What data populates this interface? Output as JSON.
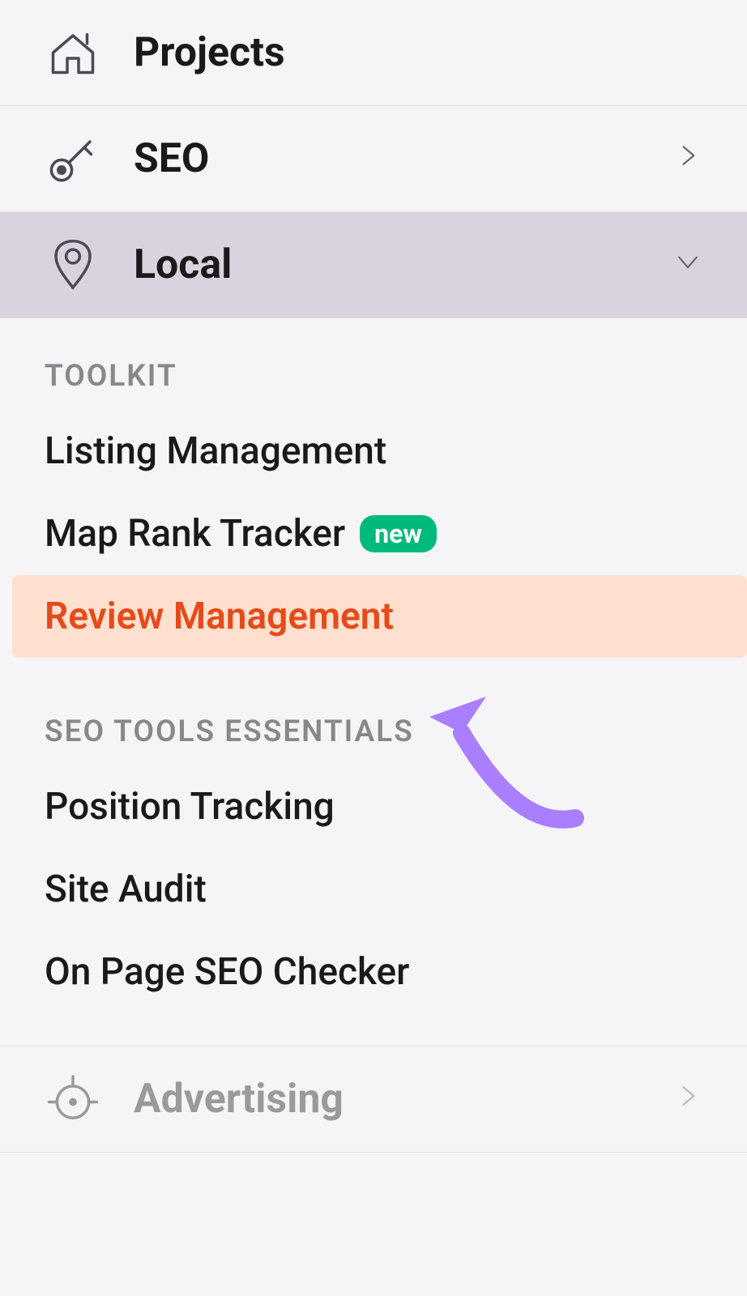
{
  "nav": {
    "projects": {
      "label": "Projects"
    },
    "seo": {
      "label": "SEO"
    },
    "local": {
      "label": "Local"
    },
    "advertising": {
      "label": "Advertising"
    }
  },
  "sections": {
    "toolkit": {
      "heading": "TOOLKIT",
      "items": [
        {
          "label": "Listing Management",
          "badge": null,
          "selected": false
        },
        {
          "label": "Map Rank Tracker",
          "badge": "new",
          "selected": false
        },
        {
          "label": "Review Management",
          "badge": null,
          "selected": true
        }
      ]
    },
    "seo_tools_essentials": {
      "heading": "SEO TOOLS ESSENTIALS",
      "items": [
        {
          "label": "Position Tracking"
        },
        {
          "label": "Site Audit"
        },
        {
          "label": "On Page SEO Checker"
        }
      ]
    }
  }
}
